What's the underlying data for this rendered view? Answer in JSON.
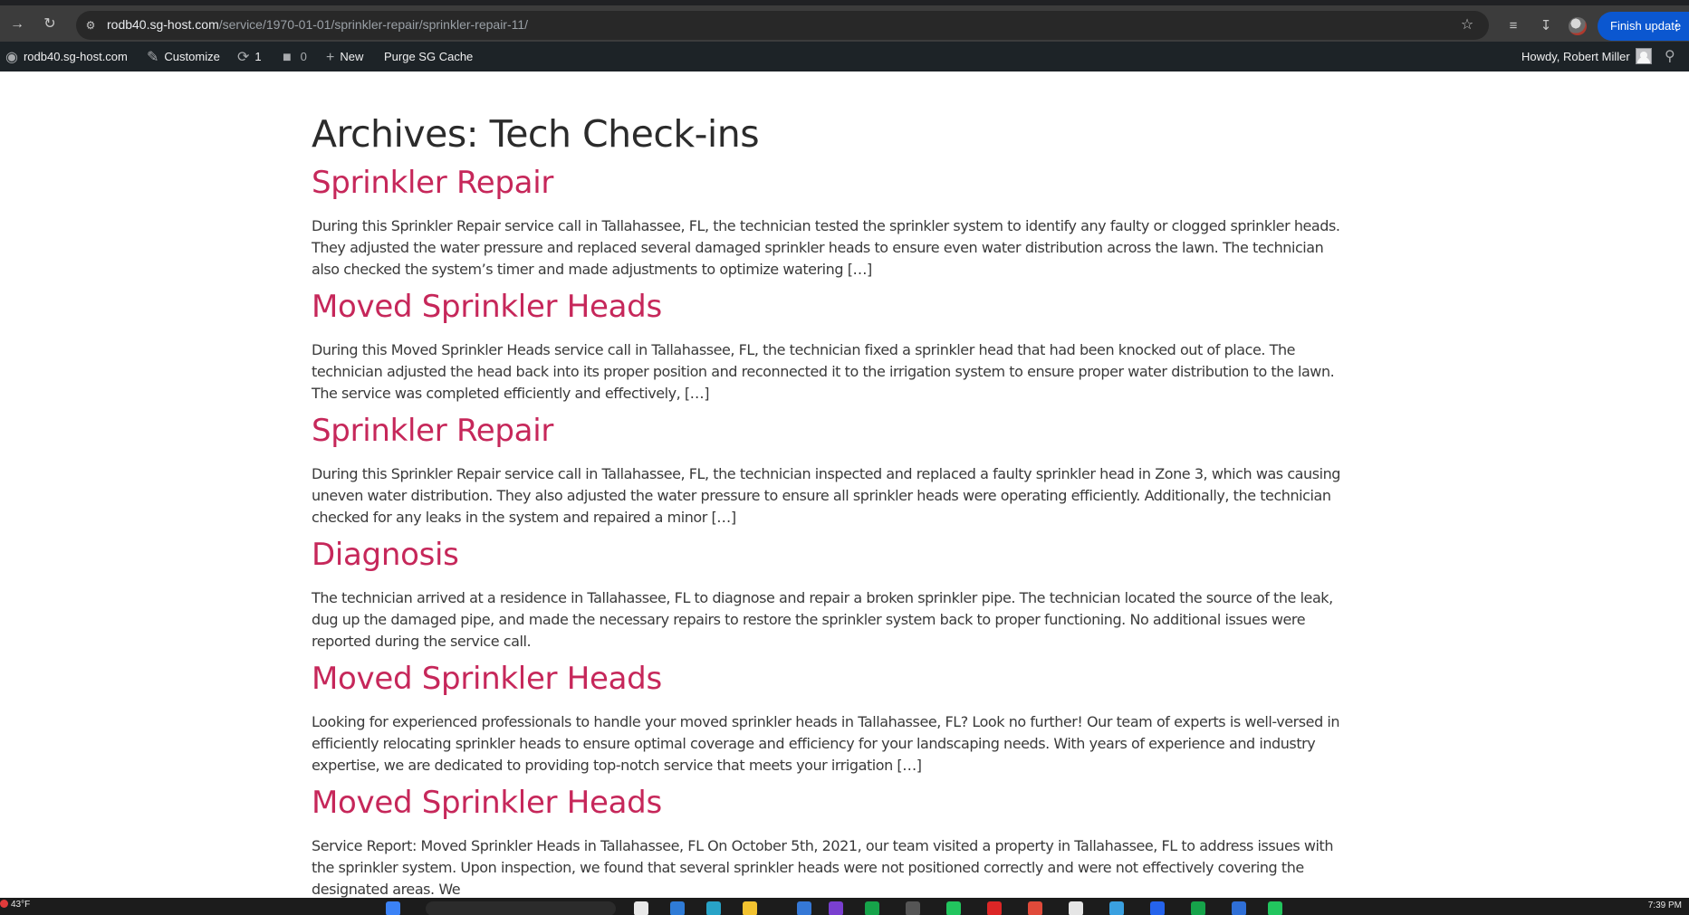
{
  "browser": {
    "url_host": "rodb40.sg-host.com",
    "url_path": "/service/1970-01-01/sprinkler-repair/sprinkler-repair-11/",
    "finish_update_label": "Finish update",
    "icons": [
      "forward-icon",
      "reload-icon",
      "site-info-icon",
      "bookmark-star-icon",
      "reading-list-icon",
      "download-icon",
      "profile-avatar",
      "kebab-menu-icon"
    ]
  },
  "admin_bar": {
    "site_name": "rodb40.sg-host.com",
    "customize": "Customize",
    "updates_count": "1",
    "comments_count": "0",
    "new": "New",
    "purge": "Purge SG Cache",
    "howdy": "Howdy, Robert Miller"
  },
  "page": {
    "archive_title": "Archives: Tech Check-ins",
    "posts": [
      {
        "title": "Sprinkler Repair",
        "excerpt": "During this Sprinkler Repair service call in Tallahassee, FL, the technician tested the sprinkler system to identify any faulty or clogged sprinkler heads. They adjusted the water pressure and replaced several damaged sprinkler heads to ensure even water distribution across the lawn. The technician also checked the system’s timer and made adjustments to optimize watering […]"
      },
      {
        "title": "Moved Sprinkler Heads",
        "excerpt": "During this Moved Sprinkler Heads service call in Tallahassee, FL, the technician fixed a sprinkler head that had been knocked out of place. The technician adjusted the head back into its proper position and reconnected it to the irrigation system to ensure proper water distribution to the lawn. The service was completed efficiently and effectively, […]"
      },
      {
        "title": "Sprinkler Repair",
        "excerpt": "During this Sprinkler Repair service call in Tallahassee, FL, the technician inspected and replaced a faulty sprinkler head in Zone 3, which was causing uneven water distribution. They also adjusted the water pressure to ensure all sprinkler heads were operating efficiently. Additionally, the technician checked for any leaks in the system and repaired a minor […]"
      },
      {
        "title": "Diagnosis",
        "excerpt": "The technician arrived at a residence in Tallahassee, FL to diagnose and repair a broken sprinkler pipe. The technician located the source of the leak, dug up the damaged pipe, and made the necessary repairs to restore the sprinkler system back to proper functioning. No additional issues were reported during the service call."
      },
      {
        "title": "Moved Sprinkler Heads",
        "excerpt": "Looking for experienced professionals to handle your moved sprinkler heads in Tallahassee, FL? Look no further! Our team of experts is well-versed in efficiently relocating sprinkler heads to ensure optimal coverage and efficiency for your landscaping needs. With years of experience and industry expertise, we are dedicated to providing top-notch service that meets your irrigation […]"
      },
      {
        "title": "Moved Sprinkler Heads",
        "excerpt": "Service Report: Moved Sprinkler Heads in Tallahassee, FL On October 5th, 2021, our team visited a property in Tallahassee, FL to address issues with the sprinkler system. Upon inspection, we found that several sprinkler heads were not positioned correctly and were not effectively covering the designated areas. We"
      }
    ]
  },
  "taskbar": {
    "weather": "43°F",
    "clock": "7:39 PM"
  },
  "colors": {
    "link": "#c6275a",
    "admin_bar": "#1d2327",
    "update_button": "#0b57d0"
  }
}
